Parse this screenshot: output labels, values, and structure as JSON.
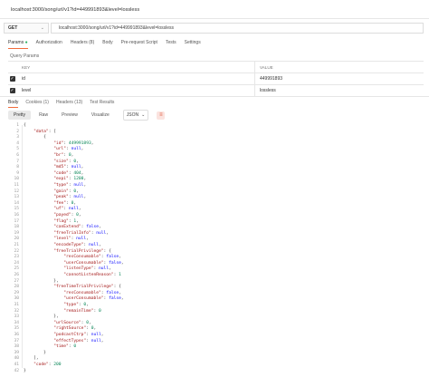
{
  "request_name": "localhost:3000/song/url/v1?id=449991893&level=lossless",
  "method": "GET",
  "url": "localhost:3000/song/url/v1?id=449991893&level=lossless",
  "request_tabs": [
    {
      "label": "Params",
      "active": true,
      "dot": true
    },
    {
      "label": "Authorization"
    },
    {
      "label": "Headers (8)"
    },
    {
      "label": "Body"
    },
    {
      "label": "Pre-request Script"
    },
    {
      "label": "Tests"
    },
    {
      "label": "Settings"
    }
  ],
  "query_params_title": "Query Params",
  "params_table": {
    "headers": [
      "KEY",
      "VALUE"
    ],
    "rows": [
      {
        "checked": true,
        "key": "id",
        "value": "449991893"
      },
      {
        "checked": true,
        "key": "level",
        "value": "lossless"
      }
    ]
  },
  "response_tabs": [
    {
      "label": "Body",
      "active": true
    },
    {
      "label": "Cookies (1)"
    },
    {
      "label": "Headers (13)"
    },
    {
      "label": "Test Results"
    }
  ],
  "format_buttons": [
    "Pretty",
    "Raw",
    "Preview",
    "Visualize"
  ],
  "format_select": "JSON",
  "colors": {
    "accent": "#f26b3a",
    "key": "#a31515",
    "string": "#0451a5",
    "number": "#098658",
    "keyword": "#0000ff"
  },
  "code_lines": [
    [
      {
        "t": "{",
        "c": "p"
      }
    ],
    [
      {
        "t": "    ",
        "c": "p"
      },
      {
        "t": "\"data\"",
        "c": "k"
      },
      {
        "t": ": [",
        "c": "p"
      }
    ],
    [
      {
        "t": "        {",
        "c": "p"
      }
    ],
    [
      {
        "t": "            ",
        "c": "p"
      },
      {
        "t": "\"id\"",
        "c": "k"
      },
      {
        "t": ": ",
        "c": "p"
      },
      {
        "t": "449991893",
        "c": "n"
      },
      {
        "t": ",",
        "c": "p"
      }
    ],
    [
      {
        "t": "            ",
        "c": "p"
      },
      {
        "t": "\"url\"",
        "c": "k"
      },
      {
        "t": ": ",
        "c": "p"
      },
      {
        "t": "null",
        "c": "b"
      },
      {
        "t": ",",
        "c": "p"
      }
    ],
    [
      {
        "t": "            ",
        "c": "p"
      },
      {
        "t": "\"br\"",
        "c": "k"
      },
      {
        "t": ": ",
        "c": "p"
      },
      {
        "t": "0",
        "c": "n"
      },
      {
        "t": ",",
        "c": "p"
      }
    ],
    [
      {
        "t": "            ",
        "c": "p"
      },
      {
        "t": "\"size\"",
        "c": "k"
      },
      {
        "t": ": ",
        "c": "p"
      },
      {
        "t": "0",
        "c": "n"
      },
      {
        "t": ",",
        "c": "p"
      }
    ],
    [
      {
        "t": "            ",
        "c": "p"
      },
      {
        "t": "\"md5\"",
        "c": "k"
      },
      {
        "t": ": ",
        "c": "p"
      },
      {
        "t": "null",
        "c": "b"
      },
      {
        "t": ",",
        "c": "p"
      }
    ],
    [
      {
        "t": "            ",
        "c": "p"
      },
      {
        "t": "\"code\"",
        "c": "k"
      },
      {
        "t": ": ",
        "c": "p"
      },
      {
        "t": "404",
        "c": "n"
      },
      {
        "t": ",",
        "c": "p"
      }
    ],
    [
      {
        "t": "            ",
        "c": "p"
      },
      {
        "t": "\"expi\"",
        "c": "k"
      },
      {
        "t": ": ",
        "c": "p"
      },
      {
        "t": "1200",
        "c": "n"
      },
      {
        "t": ",",
        "c": "p"
      }
    ],
    [
      {
        "t": "            ",
        "c": "p"
      },
      {
        "t": "\"type\"",
        "c": "k"
      },
      {
        "t": ": ",
        "c": "p"
      },
      {
        "t": "null",
        "c": "b"
      },
      {
        "t": ",",
        "c": "p"
      }
    ],
    [
      {
        "t": "            ",
        "c": "p"
      },
      {
        "t": "\"gain\"",
        "c": "k"
      },
      {
        "t": ": ",
        "c": "p"
      },
      {
        "t": "0",
        "c": "n"
      },
      {
        "t": ",",
        "c": "p"
      }
    ],
    [
      {
        "t": "            ",
        "c": "p"
      },
      {
        "t": "\"peak\"",
        "c": "k"
      },
      {
        "t": ": ",
        "c": "p"
      },
      {
        "t": "null",
        "c": "b"
      },
      {
        "t": ",",
        "c": "p"
      }
    ],
    [
      {
        "t": "            ",
        "c": "p"
      },
      {
        "t": "\"fee\"",
        "c": "k"
      },
      {
        "t": ": ",
        "c": "p"
      },
      {
        "t": "0",
        "c": "n"
      },
      {
        "t": ",",
        "c": "p"
      }
    ],
    [
      {
        "t": "            ",
        "c": "p"
      },
      {
        "t": "\"uf\"",
        "c": "k"
      },
      {
        "t": ": ",
        "c": "p"
      },
      {
        "t": "null",
        "c": "b"
      },
      {
        "t": ",",
        "c": "p"
      }
    ],
    [
      {
        "t": "            ",
        "c": "p"
      },
      {
        "t": "\"payed\"",
        "c": "k"
      },
      {
        "t": ": ",
        "c": "p"
      },
      {
        "t": "0",
        "c": "n"
      },
      {
        "t": ",",
        "c": "p"
      }
    ],
    [
      {
        "t": "            ",
        "c": "p"
      },
      {
        "t": "\"flag\"",
        "c": "k"
      },
      {
        "t": ": ",
        "c": "p"
      },
      {
        "t": "1",
        "c": "n"
      },
      {
        "t": ",",
        "c": "p"
      }
    ],
    [
      {
        "t": "            ",
        "c": "p"
      },
      {
        "t": "\"canExtend\"",
        "c": "k"
      },
      {
        "t": ": ",
        "c": "p"
      },
      {
        "t": "false",
        "c": "b"
      },
      {
        "t": ",",
        "c": "p"
      }
    ],
    [
      {
        "t": "            ",
        "c": "p"
      },
      {
        "t": "\"freeTrialInfo\"",
        "c": "k"
      },
      {
        "t": ": ",
        "c": "p"
      },
      {
        "t": "null",
        "c": "b"
      },
      {
        "t": ",",
        "c": "p"
      }
    ],
    [
      {
        "t": "            ",
        "c": "p"
      },
      {
        "t": "\"level\"",
        "c": "k"
      },
      {
        "t": ": ",
        "c": "p"
      },
      {
        "t": "null",
        "c": "b"
      },
      {
        "t": ",",
        "c": "p"
      }
    ],
    [
      {
        "t": "            ",
        "c": "p"
      },
      {
        "t": "\"encodeType\"",
        "c": "k"
      },
      {
        "t": ": ",
        "c": "p"
      },
      {
        "t": "null",
        "c": "b"
      },
      {
        "t": ",",
        "c": "p"
      }
    ],
    [
      {
        "t": "            ",
        "c": "p"
      },
      {
        "t": "\"freeTrialPrivilege\"",
        "c": "k"
      },
      {
        "t": ": {",
        "c": "p"
      }
    ],
    [
      {
        "t": "                ",
        "c": "p"
      },
      {
        "t": "\"resConsumable\"",
        "c": "k"
      },
      {
        "t": ": ",
        "c": "p"
      },
      {
        "t": "false",
        "c": "b"
      },
      {
        "t": ",",
        "c": "p"
      }
    ],
    [
      {
        "t": "                ",
        "c": "p"
      },
      {
        "t": "\"userConsumable\"",
        "c": "k"
      },
      {
        "t": ": ",
        "c": "p"
      },
      {
        "t": "false",
        "c": "b"
      },
      {
        "t": ",",
        "c": "p"
      }
    ],
    [
      {
        "t": "                ",
        "c": "p"
      },
      {
        "t": "\"listenType\"",
        "c": "k"
      },
      {
        "t": ": ",
        "c": "p"
      },
      {
        "t": "null",
        "c": "b"
      },
      {
        "t": ",",
        "c": "p"
      }
    ],
    [
      {
        "t": "                ",
        "c": "p"
      },
      {
        "t": "\"cannotListenReason\"",
        "c": "k"
      },
      {
        "t": ": ",
        "c": "p"
      },
      {
        "t": "1",
        "c": "n"
      }
    ],
    [
      {
        "t": "            },",
        "c": "p"
      }
    ],
    [
      {
        "t": "            ",
        "c": "p"
      },
      {
        "t": "\"freeTimeTrialPrivilege\"",
        "c": "k"
      },
      {
        "t": ": {",
        "c": "p"
      }
    ],
    [
      {
        "t": "                ",
        "c": "p"
      },
      {
        "t": "\"resConsumable\"",
        "c": "k"
      },
      {
        "t": ": ",
        "c": "p"
      },
      {
        "t": "false",
        "c": "b"
      },
      {
        "t": ",",
        "c": "p"
      }
    ],
    [
      {
        "t": "                ",
        "c": "p"
      },
      {
        "t": "\"userConsumable\"",
        "c": "k"
      },
      {
        "t": ": ",
        "c": "p"
      },
      {
        "t": "false",
        "c": "b"
      },
      {
        "t": ",",
        "c": "p"
      }
    ],
    [
      {
        "t": "                ",
        "c": "p"
      },
      {
        "t": "\"type\"",
        "c": "k"
      },
      {
        "t": ": ",
        "c": "p"
      },
      {
        "t": "0",
        "c": "n"
      },
      {
        "t": ",",
        "c": "p"
      }
    ],
    [
      {
        "t": "                ",
        "c": "p"
      },
      {
        "t": "\"remainTime\"",
        "c": "k"
      },
      {
        "t": ": ",
        "c": "p"
      },
      {
        "t": "0",
        "c": "n"
      }
    ],
    [
      {
        "t": "            },",
        "c": "p"
      }
    ],
    [
      {
        "t": "            ",
        "c": "p"
      },
      {
        "t": "\"urlSource\"",
        "c": "k"
      },
      {
        "t": ": ",
        "c": "p"
      },
      {
        "t": "0",
        "c": "n"
      },
      {
        "t": ",",
        "c": "p"
      }
    ],
    [
      {
        "t": "            ",
        "c": "p"
      },
      {
        "t": "\"rightSource\"",
        "c": "k"
      },
      {
        "t": ": ",
        "c": "p"
      },
      {
        "t": "0",
        "c": "n"
      },
      {
        "t": ",",
        "c": "p"
      }
    ],
    [
      {
        "t": "            ",
        "c": "p"
      },
      {
        "t": "\"podcastCtrp\"",
        "c": "k"
      },
      {
        "t": ": ",
        "c": "p"
      },
      {
        "t": "null",
        "c": "b"
      },
      {
        "t": ",",
        "c": "p"
      }
    ],
    [
      {
        "t": "            ",
        "c": "p"
      },
      {
        "t": "\"effectTypes\"",
        "c": "k"
      },
      {
        "t": ": ",
        "c": "p"
      },
      {
        "t": "null",
        "c": "b"
      },
      {
        "t": ",",
        "c": "p"
      }
    ],
    [
      {
        "t": "            ",
        "c": "p"
      },
      {
        "t": "\"time\"",
        "c": "k"
      },
      {
        "t": ": ",
        "c": "p"
      },
      {
        "t": "0",
        "c": "n"
      }
    ],
    [
      {
        "t": "        }",
        "c": "p"
      }
    ],
    [
      {
        "t": "    ],",
        "c": "p"
      }
    ],
    [
      {
        "t": "    ",
        "c": "p"
      },
      {
        "t": "\"code\"",
        "c": "k"
      },
      {
        "t": ": ",
        "c": "p"
      },
      {
        "t": "200",
        "c": "n"
      }
    ],
    [
      {
        "t": "}",
        "c": "p"
      }
    ]
  ]
}
